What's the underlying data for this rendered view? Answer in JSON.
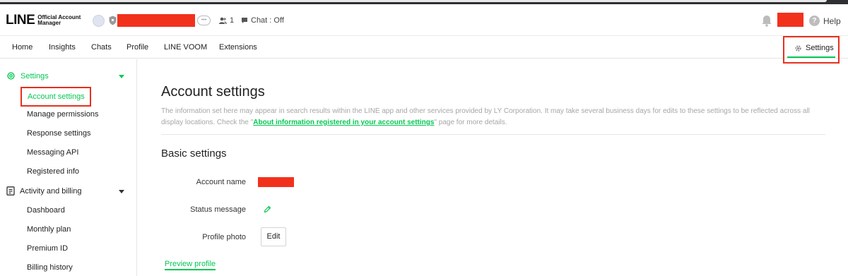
{
  "header": {
    "logo_main": "LINE",
    "logo_sub": "Official Account Manager",
    "badge": "•••",
    "friend_count": "1",
    "chat_status": "Chat : Off",
    "help_label": "Help",
    "icons": [
      "shield-icon",
      "friends-icon",
      "chat-icon",
      "bell-icon",
      "help-icon"
    ]
  },
  "nav": {
    "items": [
      "Home",
      "Insights",
      "Chats",
      "Profile",
      "LINE VOOM",
      "Extensions"
    ],
    "settings_label": "Settings"
  },
  "sidebar": {
    "sections": [
      {
        "label": "Settings",
        "icon": "gear-icon",
        "expanded": true,
        "items": [
          "Account settings",
          "Manage permissions",
          "Response settings",
          "Messaging API",
          "Registered info"
        ]
      },
      {
        "label": "Activity and billing",
        "icon": "document-icon",
        "expanded": true,
        "items": [
          "Dashboard",
          "Monthly plan",
          "Premium ID",
          "Billing history"
        ]
      }
    ]
  },
  "main": {
    "title": "Account settings",
    "description_before": "The information set here may appear in search results within the LINE app and other services provided by LY Corporation. It may take several business days for edits to these settings to be reflected across all display locations. Check the \"",
    "description_link": "About information registered in your account settings",
    "description_after": "\" page for more details.",
    "basic_title": "Basic settings",
    "fields": {
      "account_name": "Account name",
      "status_message": "Status message",
      "profile_photo": "Profile photo"
    },
    "edit_label": "Edit",
    "preview_label": "Preview profile"
  },
  "colors": {
    "brand_green": "#06c755",
    "highlight_red": "#e4311e",
    "redaction_red": "#f2311c"
  }
}
